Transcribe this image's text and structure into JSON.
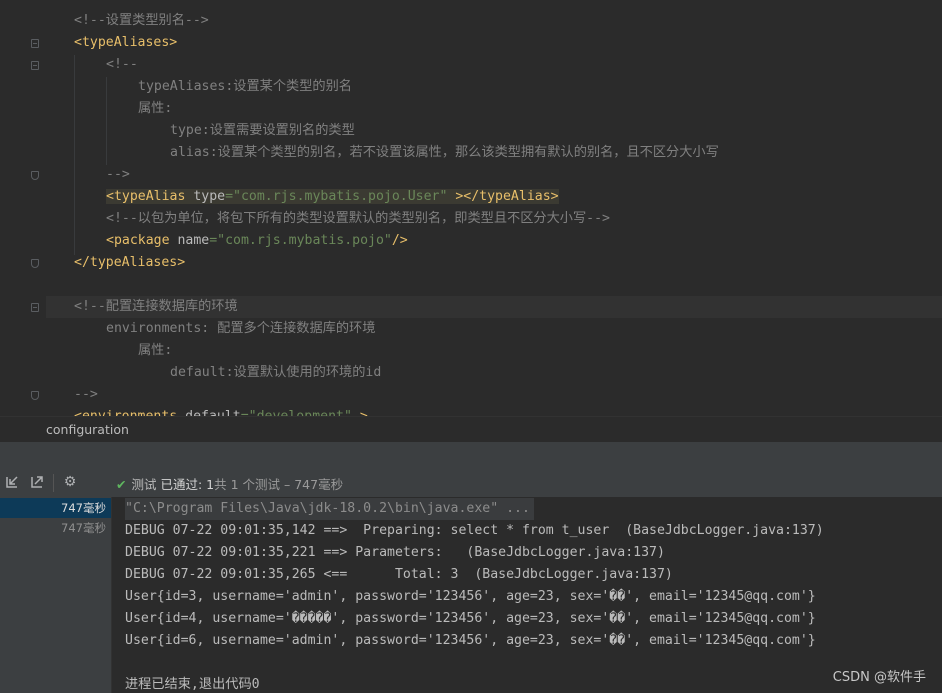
{
  "editor": {
    "lines": [
      {
        "indent": 0,
        "parts": [
          {
            "c": "cmt",
            "t": "<!--设置类型别名-->"
          }
        ]
      },
      {
        "indent": 0,
        "parts": [
          {
            "c": "tag",
            "t": "<typeAliases>"
          }
        ]
      },
      {
        "indent": 1,
        "parts": [
          {
            "c": "cmt",
            "t": "<!--"
          }
        ]
      },
      {
        "indent": 2,
        "parts": [
          {
            "c": "cmt",
            "t": "typeAliases:设置某个类型的别名"
          }
        ]
      },
      {
        "indent": 2,
        "parts": [
          {
            "c": "cmt",
            "t": "属性:"
          }
        ]
      },
      {
        "indent": 3,
        "parts": [
          {
            "c": "cmt",
            "t": "type:设置需要设置别名的类型"
          }
        ]
      },
      {
        "indent": 3,
        "parts": [
          {
            "c": "cmt",
            "t": "alias:设置某个类型的别名，若不设置该属性，那么该类型拥有默认的别名，且不区分大小写"
          }
        ]
      },
      {
        "indent": 1,
        "parts": [
          {
            "c": "cmt",
            "t": "-->"
          }
        ]
      },
      {
        "indent": 1,
        "parts": [
          {
            "c": "tag hl",
            "t": "<typeAlias "
          },
          {
            "c": "attr hl",
            "t": "type"
          },
          {
            "c": "val hl",
            "t": "=\"com.rjs.mybatis.pojo.User\" "
          },
          {
            "c": "tag hl",
            "t": "></typeAlias>"
          }
        ]
      },
      {
        "indent": 1,
        "parts": [
          {
            "c": "cmt",
            "t": "<!--以包为单位，将包下所有的类型设置默认的类型别名，即类型且不区分大小写-->"
          }
        ]
      },
      {
        "indent": 1,
        "parts": [
          {
            "c": "tag",
            "t": "<package "
          },
          {
            "c": "attr",
            "t": "name"
          },
          {
            "c": "val",
            "t": "=\"com.rjs.mybatis.pojo\""
          },
          {
            "c": "tag",
            "t": "/>"
          }
        ]
      },
      {
        "indent": 0,
        "parts": [
          {
            "c": "tag",
            "t": "</typeAliases>"
          }
        ]
      },
      {
        "indent": 0,
        "parts": []
      },
      {
        "indent": 0,
        "parts": [
          {
            "c": "cmt",
            "t": "<!--配置连接数据库的环境"
          }
        ]
      },
      {
        "indent": 1,
        "parts": [
          {
            "c": "cmt",
            "t": "environments: 配置多个连接数据库的环境"
          }
        ]
      },
      {
        "indent": 2,
        "parts": [
          {
            "c": "cmt",
            "t": "属性:"
          }
        ]
      },
      {
        "indent": 3,
        "parts": [
          {
            "c": "cmt",
            "t": "default:设置默认使用的环境的id"
          }
        ]
      },
      {
        "indent": 0,
        "parts": [
          {
            "c": "cmt",
            "t": "-->"
          }
        ]
      },
      {
        "indent": 0,
        "parts": [
          {
            "c": "tag",
            "t": "<environments "
          },
          {
            "c": "attr",
            "t": "default"
          },
          {
            "c": "val",
            "t": "=\"development\""
          },
          {
            "c": "tag",
            "t": " >"
          }
        ]
      }
    ]
  },
  "breadcrumb": {
    "label": "configuration"
  },
  "toolbar": {
    "status_prefix": "测试",
    "status_passed": "已通过: 1",
    "status_detail": "共 1 个测试 – 747毫秒"
  },
  "tree": {
    "items": [
      {
        "label": "747毫秒",
        "selected": true
      },
      {
        "label": "747毫秒",
        "selected": false
      }
    ]
  },
  "console": {
    "lines": [
      "\"C:\\Program Files\\Java\\jdk-18.0.2\\bin\\java.exe\" ...",
      "DEBUG 07-22 09:01:35,142 ==>  Preparing: select * from t_user  (BaseJdbcLogger.java:137)",
      "DEBUG 07-22 09:01:35,221 ==> Parameters:   (BaseJdbcLogger.java:137)",
      "DEBUG 07-22 09:01:35,265 <==      Total: 3  (BaseJdbcLogger.java:137)",
      "User{id=3, username='admin', password='123456', age=23, sex='��', email='12345@qq.com'}",
      "User{id=4, username='�����', password='123456', age=23, sex='��', email='12345@qq.com'}",
      "User{id=6, username='admin', password='123456', age=23, sex='��', email='12345@qq.com'}",
      "",
      "进程已结束,退出代码0"
    ]
  },
  "watermark": "CSDN @软件手",
  "colors": {
    "tag": "#e8bf6a",
    "comment": "#808080",
    "string": "#6a8759",
    "pass": "#5fb65f"
  }
}
